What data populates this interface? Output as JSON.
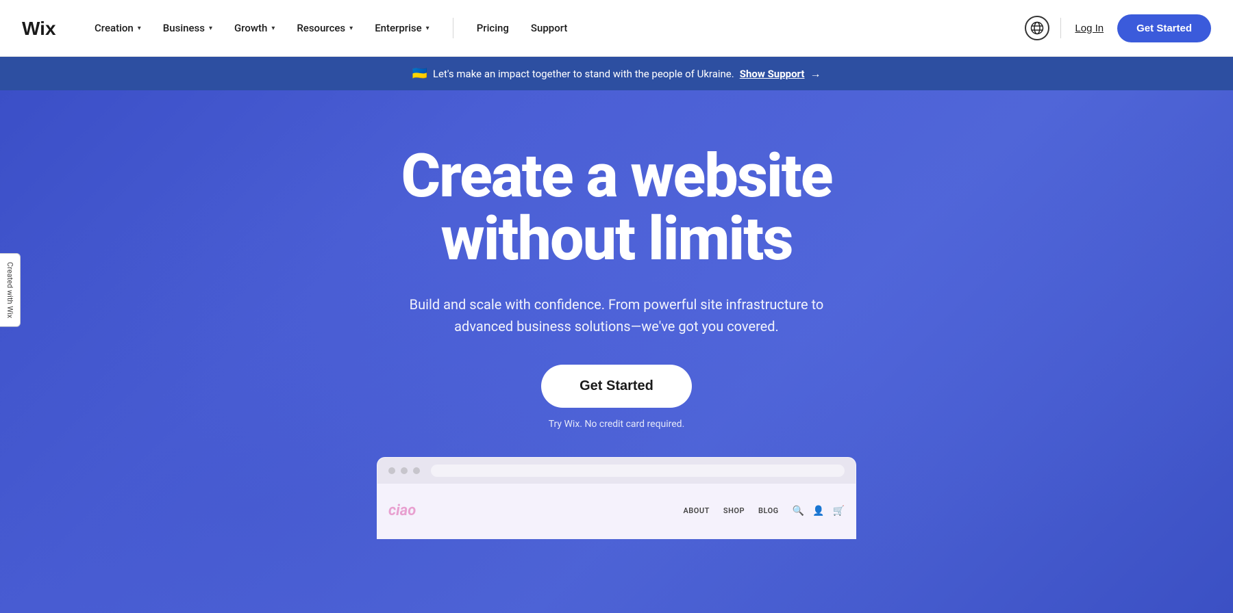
{
  "navbar": {
    "logo_text": "Wix",
    "nav_items": [
      {
        "label": "Creation",
        "has_dropdown": true
      },
      {
        "label": "Business",
        "has_dropdown": true
      },
      {
        "label": "Growth",
        "has_dropdown": true
      },
      {
        "label": "Resources",
        "has_dropdown": true
      },
      {
        "label": "Enterprise",
        "has_dropdown": true
      }
    ],
    "plain_nav_items": [
      {
        "label": "Pricing"
      },
      {
        "label": "Support"
      }
    ],
    "login_label": "Log In",
    "get_started_label": "Get Started"
  },
  "banner": {
    "flag_emoji": "🇺🇦",
    "text": "Let's make an impact together to stand with the people of Ukraine.",
    "link_text": "Show Support",
    "arrow": "→"
  },
  "hero": {
    "headline_line1": "Create a website",
    "headline_line2": "without limits",
    "subtext": "Build and scale with confidence. From powerful site infrastructure to advanced business solutions—we've got you covered.",
    "cta_label": "Get Started",
    "no_card_text": "Try Wix. No credit card required."
  },
  "browser_mockup": {
    "logo": "ciao",
    "nav_items": [
      "ABOUT",
      "SHOP",
      "BLOG"
    ],
    "icons": [
      "🔍",
      "👤",
      "🛒"
    ]
  },
  "side_tab": {
    "label": "Created with Wix"
  }
}
